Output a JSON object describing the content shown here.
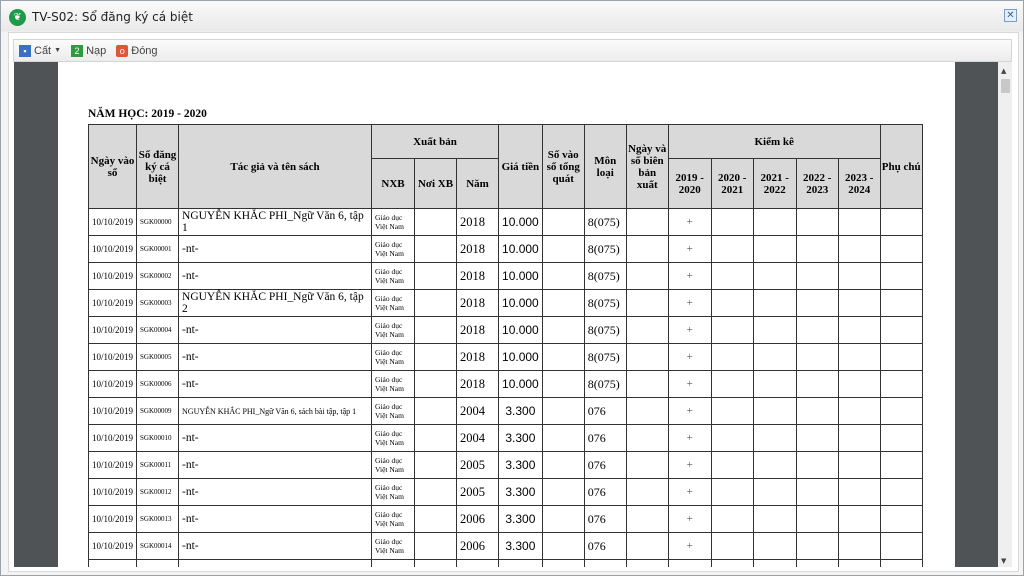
{
  "window": {
    "title": "TV-S02: Sổ đăng ký cá biệt"
  },
  "toolbar": {
    "save": "Cất",
    "reload": "Nạp",
    "close": "Đóng"
  },
  "report": {
    "year_label": "NĂM HỌC: 2019 - 2020",
    "headers": {
      "date": "Ngày vào sổ",
      "reg_no": "Số đăng ký cá biệt",
      "title": "Tác giả và tên sách",
      "publish": "Xuất bản",
      "nxb": "NXB",
      "place": "Nơi XB",
      "year": "Năm",
      "price": "Giá tiền",
      "general_no": "Số vào sổ tổng quát",
      "category": "Môn loại",
      "removal": "Ngày và số biên bản xuất",
      "inventory": "Kiểm kê",
      "years": [
        "2019 - 2020",
        "2020 - 2021",
        "2021 - 2022",
        "2022 - 2023",
        "2023 - 2024"
      ],
      "note": "Phụ chú"
    },
    "rows": [
      {
        "date": "10/10/2019",
        "reg": "SGK00000",
        "title": "NGUYỄN KHẮC PHI_Ngữ Văn 6, tập 1",
        "nxb": "Giáo dục Việt Nam",
        "year": "2018",
        "price": "10.000",
        "cat": "8(075)",
        "k1": "+"
      },
      {
        "date": "10/10/2019",
        "reg": "SGK00001",
        "title": "-nt-",
        "nxb": "Giáo dục Việt Nam",
        "year": "2018",
        "price": "10.000",
        "cat": "8(075)",
        "k1": "+"
      },
      {
        "date": "10/10/2019",
        "reg": "SGK00002",
        "title": "-nt-",
        "nxb": "Giáo dục Việt Nam",
        "year": "2018",
        "price": "10.000",
        "cat": "8(075)",
        "k1": "+"
      },
      {
        "date": "10/10/2019",
        "reg": "SGK00003",
        "title": "NGUYỄN KHẮC PHI_Ngữ Văn 6, tập 2",
        "nxb": "Giáo dục Việt Nam",
        "year": "2018",
        "price": "10.000",
        "cat": "8(075)",
        "k1": "+"
      },
      {
        "date": "10/10/2019",
        "reg": "SGK00004",
        "title": "-nt-",
        "nxb": "Giáo dục Việt Nam",
        "year": "2018",
        "price": "10.000",
        "cat": "8(075)",
        "k1": "+"
      },
      {
        "date": "10/10/2019",
        "reg": "SGK00005",
        "title": "-nt-",
        "nxb": "Giáo dục Việt Nam",
        "year": "2018",
        "price": "10.000",
        "cat": "8(075)",
        "k1": "+"
      },
      {
        "date": "10/10/2019",
        "reg": "SGK00006",
        "title": "-nt-",
        "nxb": "Giáo dục Việt Nam",
        "year": "2018",
        "price": "10.000",
        "cat": "8(075)",
        "k1": "+"
      },
      {
        "date": "10/10/2019",
        "reg": "SGK00009",
        "title": "NGUYỄN KHẮC PHI_Ngữ Văn 6, sách bài tập, tập 1",
        "nxb": "Giáo dục Việt Nam",
        "year": "2004",
        "price": "3.300",
        "cat": "076",
        "k1": "+"
      },
      {
        "date": "10/10/2019",
        "reg": "SGK00010",
        "title": "-nt-",
        "nxb": "Giáo dục Việt Nam",
        "year": "2004",
        "price": "3.300",
        "cat": "076",
        "k1": "+"
      },
      {
        "date": "10/10/2019",
        "reg": "SGK00011",
        "title": "-nt-",
        "nxb": "Giáo dục Việt Nam",
        "year": "2005",
        "price": "3.300",
        "cat": "076",
        "k1": "+"
      },
      {
        "date": "10/10/2019",
        "reg": "SGK00012",
        "title": "-nt-",
        "nxb": "Giáo dục Việt Nam",
        "year": "2005",
        "price": "3.300",
        "cat": "076",
        "k1": "+"
      },
      {
        "date": "10/10/2019",
        "reg": "SGK00013",
        "title": "-nt-",
        "nxb": "Giáo dục Việt Nam",
        "year": "2006",
        "price": "3.300",
        "cat": "076",
        "k1": "+"
      },
      {
        "date": "10/10/2019",
        "reg": "SGK00014",
        "title": "-nt-",
        "nxb": "Giáo dục Việt Nam",
        "year": "2006",
        "price": "3.300",
        "cat": "076",
        "k1": "+"
      }
    ]
  }
}
